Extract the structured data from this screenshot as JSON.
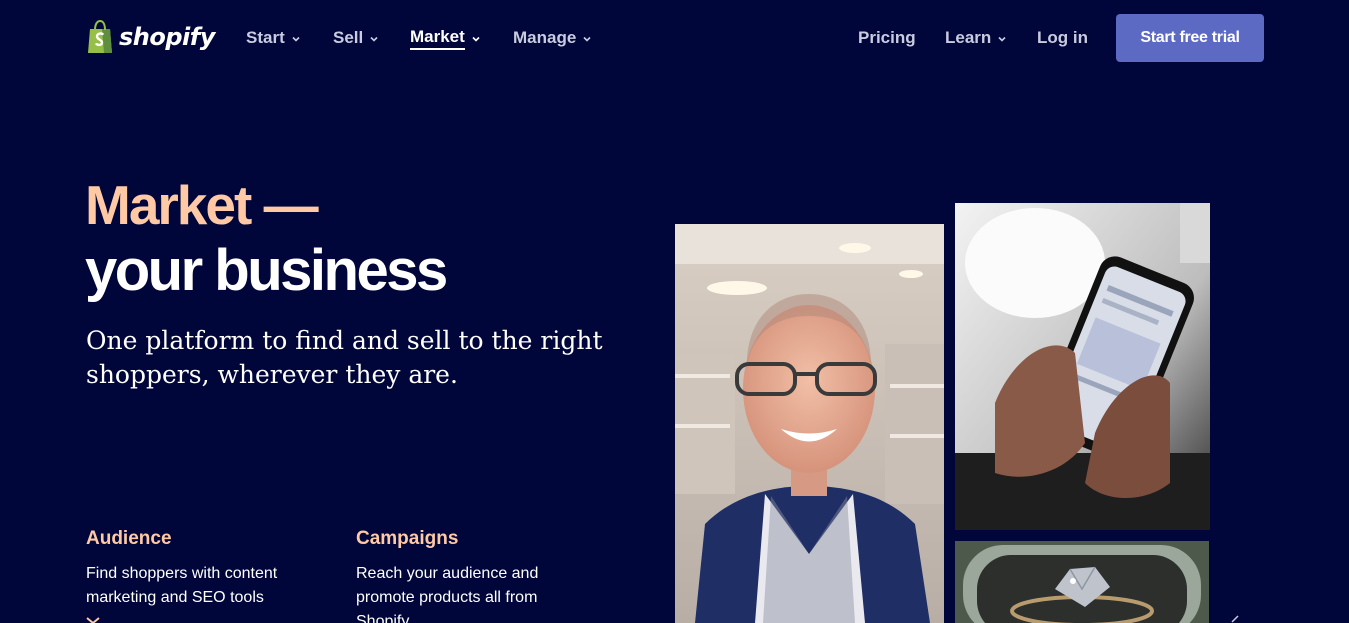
{
  "brand": {
    "name": "shopify",
    "logo_icon": "shopping-bag-icon",
    "bag_color": "#95bf47"
  },
  "nav": {
    "items": [
      {
        "label": "Start",
        "has_dropdown": true,
        "active": false
      },
      {
        "label": "Sell",
        "has_dropdown": true,
        "active": false
      },
      {
        "label": "Market",
        "has_dropdown": true,
        "active": true
      },
      {
        "label": "Manage",
        "has_dropdown": true,
        "active": false
      }
    ],
    "right": [
      {
        "label": "Pricing",
        "has_dropdown": false
      },
      {
        "label": "Learn",
        "has_dropdown": true
      },
      {
        "label": "Log in",
        "has_dropdown": false
      }
    ],
    "cta_label": "Start free trial",
    "cta_color": "#5c6ac4"
  },
  "hero": {
    "eyebrow": "Market —",
    "title": "your business",
    "subtitle": "One platform to find and sell to the right shoppers, wherever they are."
  },
  "features": [
    {
      "title": "Audience",
      "description": "Find shoppers with content marketing and SEO tools"
    },
    {
      "title": "Campaigns",
      "description": "Reach your audience and promote products all from Shopify"
    }
  ],
  "photos": [
    {
      "subject": "smiling man with glasses in a shop"
    },
    {
      "subject": "hands holding a smartphone"
    },
    {
      "subject": "diamond ring in a box"
    }
  ],
  "colors": {
    "background": "#000639",
    "accent_peach": "#ffc9a5",
    "nav_text": "#c9cbe0"
  }
}
